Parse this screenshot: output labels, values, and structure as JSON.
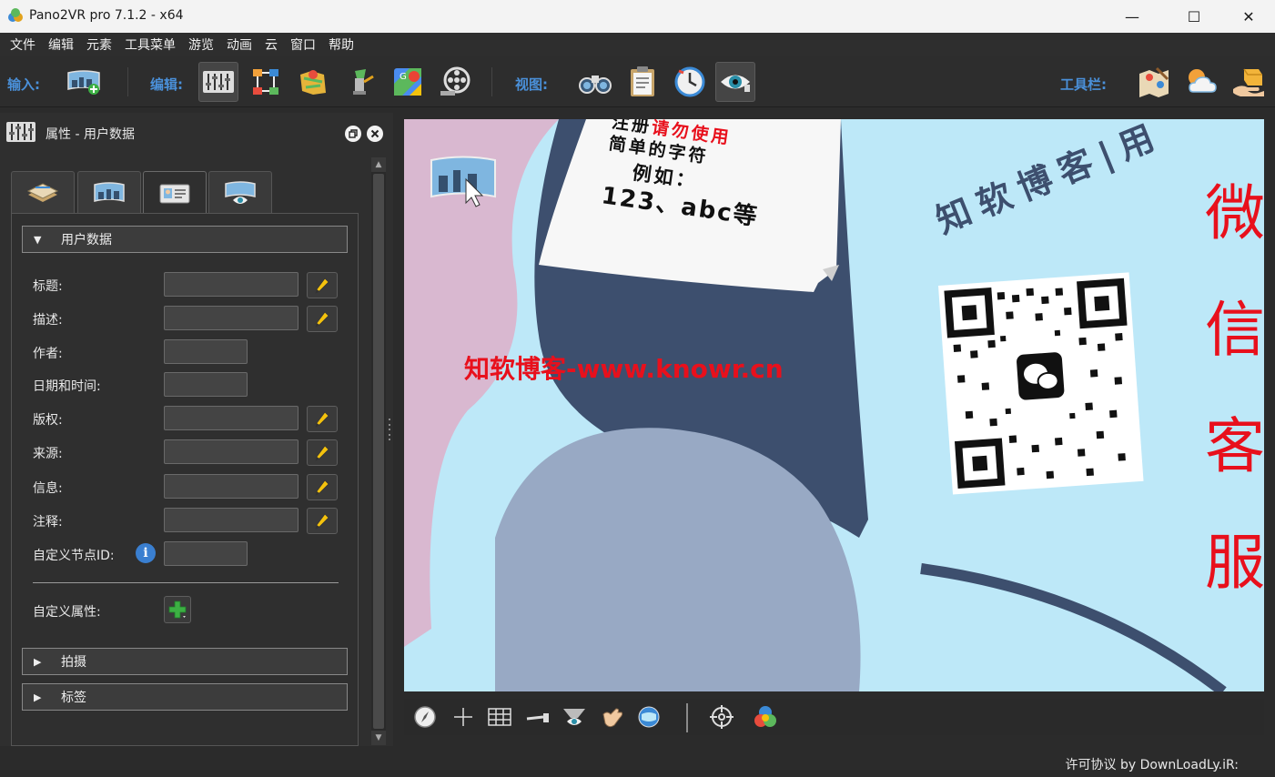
{
  "window": {
    "title": "Pano2VR pro 7.1.2 - x64",
    "minimize_glyph": "—",
    "maximize_glyph": "☐",
    "close_glyph": "✕"
  },
  "menu": [
    "文件",
    "编辑",
    "元素",
    "工具菜单",
    "游览",
    "动画",
    "云",
    "窗口",
    "帮助"
  ],
  "toolbar": {
    "input_label": "输入:",
    "edit_label": "编辑:",
    "view_label": "视图:",
    "tools_label": "工具栏:"
  },
  "panel": {
    "title": "属性 - 用户数据",
    "sections": {
      "user_data": "用户数据",
      "capture": "拍摄",
      "tags": "标签"
    },
    "fields": [
      {
        "label": "标题:",
        "value": ""
      },
      {
        "label": "描述:",
        "value": ""
      },
      {
        "label": "作者:",
        "value": ""
      },
      {
        "label": "日期和时间:",
        "value": ""
      },
      {
        "label": "版权:",
        "value": ""
      },
      {
        "label": "来源:",
        "value": ""
      },
      {
        "label": "信息:",
        "value": ""
      },
      {
        "label": "注释:",
        "value": ""
      },
      {
        "label": "自定义节点ID:",
        "value": ""
      }
    ],
    "custom_props_label": "自定义属性:",
    "info_glyph": "i"
  },
  "viewer": {
    "watermark": "知软博客-www.knowr.cn",
    "sign_lines": [
      "注册请勿使用",
      "简单的字符",
      "例如：",
      "123、abc等"
    ],
    "sign_highlight": "请勿使用",
    "sign_prefix": "注册",
    "blog_text": "知软博客|用",
    "side_chars": [
      "微",
      "信",
      "客",
      "服"
    ]
  },
  "status": {
    "text": "许可协议 by DownLoadLy.iR:"
  },
  "colors": {
    "accent_blue": "#4a90d9",
    "watermark_red": "#e8101c",
    "viewer_sky": "#bde8f8",
    "viewer_navy": "#3d4f6e"
  }
}
